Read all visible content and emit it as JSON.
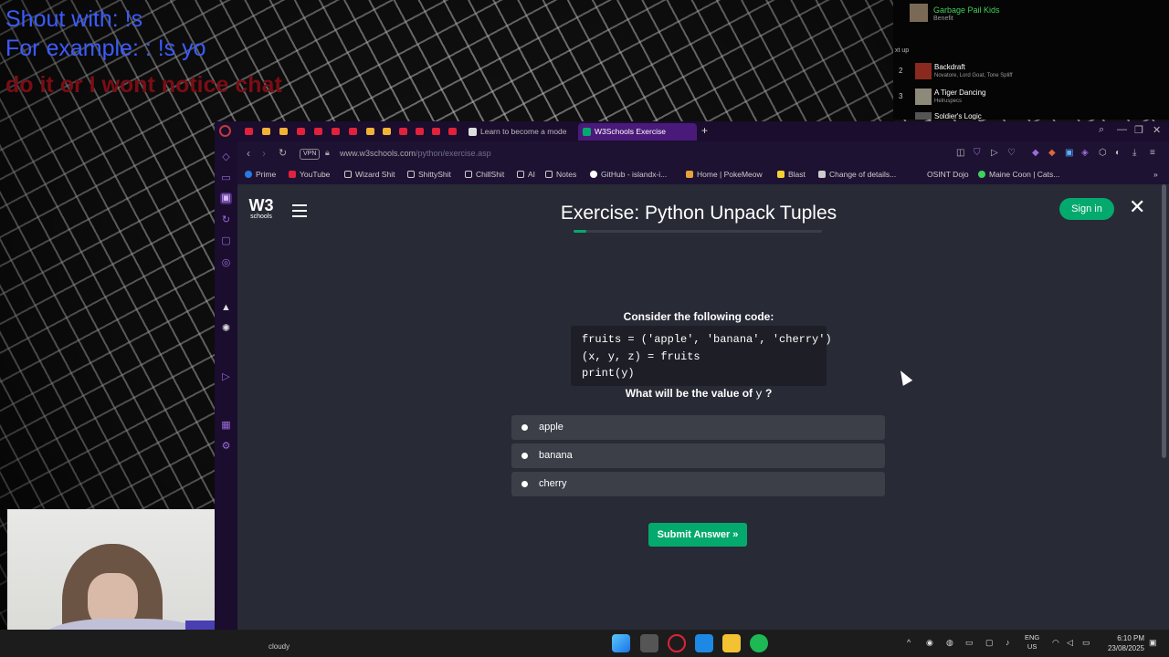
{
  "stream_overlay": {
    "line1": "Shout with: !s",
    "line2": "For example: : !s yo",
    "line3": "do it or I wont notice chat"
  },
  "music": {
    "now_playing_title": "Garbage Pail Kids",
    "now_playing_artist": "Benefit",
    "next_up_label": "xt up",
    "queue": [
      {
        "num": "2",
        "title": "Backdraft",
        "artist": "Novatore, Lord Goat, Tone Spliff"
      },
      {
        "num": "3",
        "title": "A Tiger Dancing",
        "artist": "Helruspecs"
      },
      {
        "num": "",
        "title": "Soldier's Logic",
        "artist": ""
      }
    ]
  },
  "browser": {
    "tabs": {
      "inactive_label": "Learn to become a mode",
      "active_label": "W3Schools Exercise",
      "new_tab": "+"
    },
    "address": {
      "vpn": "VPN",
      "url_host": "www.w3schools.com",
      "url_path": "/python/exercise.asp"
    },
    "bookmarks": [
      "Prime",
      "YouTube",
      "Wizard Shit",
      "ShittyShit",
      "ChillShit",
      "AI",
      "Notes",
      "GitHub - islandx-i...",
      "Home | PokeMeow",
      "Blast",
      "Change of details...",
      "OSINT Dojo",
      "Maine Coon | Cats..."
    ]
  },
  "page": {
    "logo_w3": "W3",
    "logo_schools": "schools",
    "title": "Exercise: Python Unpack Tuples",
    "sign_in": "Sign in",
    "close": "✕",
    "progress_fraction": 0.05,
    "intro": "Consider the following code:",
    "code": "fruits = ('apple', 'banana', 'cherry')\n(x, y, z) = fruits\nprint(y)",
    "question_prefix": "What will be the value of",
    "question_var": "y",
    "question_suffix": "?",
    "options": [
      "apple",
      "banana",
      "cherry"
    ],
    "submit": "Submit Answer »"
  },
  "taskbar": {
    "weather": "cloudy",
    "lang_top": "ENG",
    "lang_bottom": "US",
    "time": "6:10 PM",
    "date": "23/08/2025"
  }
}
